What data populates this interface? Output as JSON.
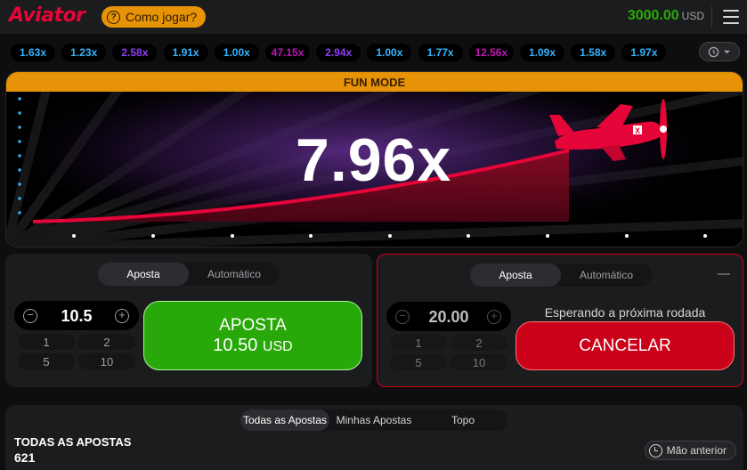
{
  "header": {
    "logo": "Aviator",
    "how_to_play": "Como jogar?",
    "how_to_icon": "?",
    "balance": "3000.00",
    "currency": "USD"
  },
  "history": {
    "items": [
      {
        "value": "1.63x",
        "color": "#34b4ff"
      },
      {
        "value": "1.23x",
        "color": "#34b4ff"
      },
      {
        "value": "2.58x",
        "color": "#913ef8"
      },
      {
        "value": "1.91x",
        "color": "#34b4ff"
      },
      {
        "value": "1.00x",
        "color": "#34b4ff"
      },
      {
        "value": "47.15x",
        "color": "#c017b4"
      },
      {
        "value": "2.94x",
        "color": "#913ef8"
      },
      {
        "value": "1.00x",
        "color": "#34b4ff"
      },
      {
        "value": "1.77x",
        "color": "#34b4ff"
      },
      {
        "value": "12.56x",
        "color": "#c017b4"
      },
      {
        "value": "1.09x",
        "color": "#34b4ff"
      },
      {
        "value": "1.58x",
        "color": "#34b4ff"
      },
      {
        "value": "1.97x",
        "color": "#34b4ff"
      }
    ],
    "toggle_icon": "history-clock-icon"
  },
  "game": {
    "mode_banner": "FUN MODE",
    "multiplier": "7.96x",
    "curve_color": "#e50539",
    "plane_icon": "airplane-icon"
  },
  "bet_panel_left": {
    "tabs": [
      "Aposta",
      "Automático"
    ],
    "active_tab": 0,
    "amount": "10.5",
    "quick_amounts": [
      "1",
      "2",
      "5",
      "10"
    ],
    "button_line1": "APOSTA",
    "button_amount": "10.50",
    "button_currency": "USD"
  },
  "bet_panel_right": {
    "tabs": [
      "Aposta",
      "Automático"
    ],
    "active_tab": 0,
    "amount": "20.00",
    "quick_amounts": [
      "1",
      "2",
      "5",
      "10"
    ],
    "status": "Esperando a próxima rodada",
    "button_label": "CANCELAR"
  },
  "bets": {
    "tabs": [
      "Todas as Apostas",
      "Minhas Apostas",
      "Topo"
    ],
    "active_tab": 0,
    "title": "TODAS AS APOSTAS",
    "count": "621",
    "previous_hand": "Mão anterior"
  }
}
